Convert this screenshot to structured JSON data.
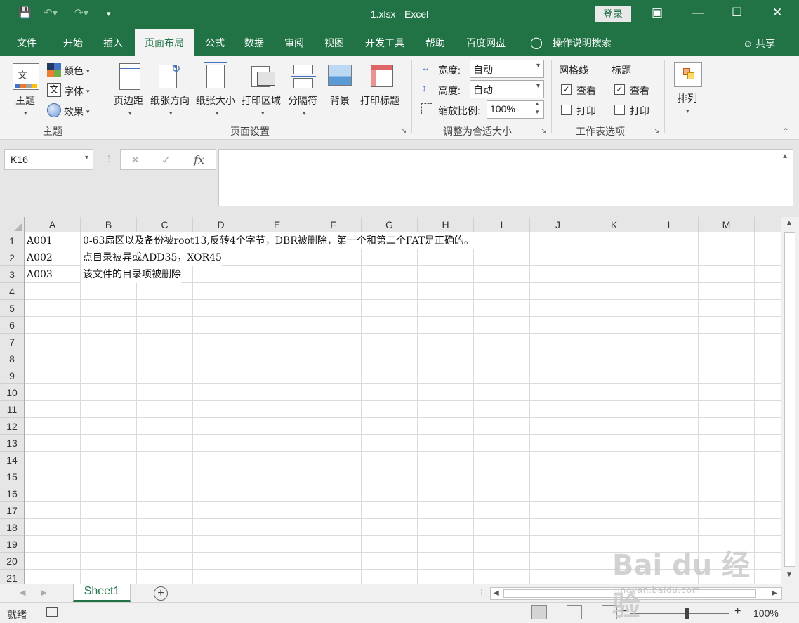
{
  "window": {
    "title": "1.xlsx  -  Excel",
    "login_label": "登录",
    "colors": {
      "accent": "#217346",
      "ribbon_bg": "#f3f3f3",
      "grid_line": "#dadada"
    }
  },
  "tabs": [
    {
      "label": "文件",
      "active": false
    },
    {
      "label": "开始",
      "active": false
    },
    {
      "label": "插入",
      "active": false
    },
    {
      "label": "页面布局",
      "active": true
    },
    {
      "label": "公式",
      "active": false
    },
    {
      "label": "数据",
      "active": false
    },
    {
      "label": "审阅",
      "active": false
    },
    {
      "label": "视图",
      "active": false
    },
    {
      "label": "开发工具",
      "active": false
    },
    {
      "label": "帮助",
      "active": false
    },
    {
      "label": "百度网盘",
      "active": false
    }
  ],
  "tell_me": "操作说明搜索",
  "share_label": "共享",
  "ribbon": {
    "themes": {
      "group_label": "主题",
      "theme_label": "主题",
      "colors_label": "颜色",
      "fonts_label": "字体",
      "effects_label": "效果"
    },
    "page_setup": {
      "group_label": "页面设置",
      "margins": "页边距",
      "orientation": "纸张方向",
      "size": "纸张大小",
      "print_area": "打印区域",
      "breaks": "分隔符",
      "background": "背景",
      "print_titles": "打印标题"
    },
    "scale_to_fit": {
      "group_label": "调整为合适大小",
      "width_label": "宽度:",
      "width_value": "自动",
      "height_label": "高度:",
      "height_value": "自动",
      "scale_label": "缩放比例:",
      "scale_value": "100%"
    },
    "sheet_options": {
      "group_label": "工作表选项",
      "gridlines_label": "网格线",
      "headings_label": "标题",
      "view_label": "查看",
      "print_label": "打印",
      "gridlines_view": true,
      "gridlines_print": false,
      "headings_view": true,
      "headings_print": false
    },
    "arrange": {
      "label": "排列"
    }
  },
  "formula_bar": {
    "name_box": "K16",
    "fx_label": "fx",
    "value": ""
  },
  "sheet": {
    "columns": [
      "A",
      "B",
      "C",
      "D",
      "E",
      "F",
      "G",
      "H",
      "I",
      "J",
      "K",
      "L",
      "M"
    ],
    "rows": [
      "1",
      "2",
      "3",
      "4",
      "5",
      "6",
      "7",
      "8",
      "9",
      "10",
      "11",
      "12",
      "13",
      "14",
      "15",
      "16",
      "17",
      "18",
      "19",
      "20",
      "21"
    ],
    "data": [
      {
        "a": "A001",
        "b": "0-63扇区以及备份被root13,反转4个字节，DBR被删除，第一个和第二个FAT是正确的。"
      },
      {
        "a": "A002",
        "b": "点目录被异或ADD35，XOR45"
      },
      {
        "a": "A003",
        "b": "该文件的目录项被删除"
      }
    ]
  },
  "sheet_tabs": [
    {
      "label": "Sheet1",
      "active": true
    }
  ],
  "status": {
    "ready": "就绪",
    "zoom": "100%"
  },
  "watermark": {
    "brand": "Bai du 经验",
    "url": "jingyan.baidu.com"
  }
}
